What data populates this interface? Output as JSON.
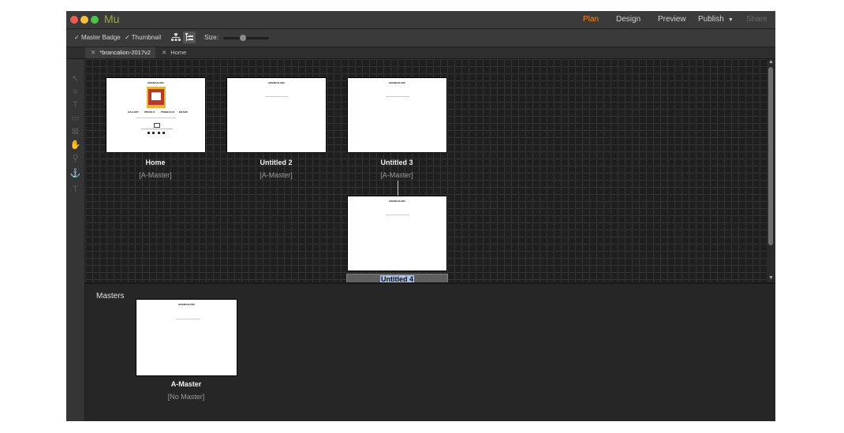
{
  "app": {
    "logo": "Mu",
    "nav": [
      "Plan",
      "Design",
      "Preview",
      "Publish",
      "Share"
    ],
    "active_nav": "Plan"
  },
  "toolbar": {
    "master_badge": "Master Badge",
    "thumbnail": "Thumbnail",
    "size_label": "Size:",
    "size_value": 0.45
  },
  "tabs": [
    "*brancalion-2017v2",
    "Home"
  ],
  "pages": [
    {
      "name": "Home",
      "master": "[A-Master]"
    },
    {
      "name": "Untitled 2",
      "master": "[A-Master]"
    },
    {
      "name": "Untitled 3",
      "master": "[A-Master]"
    },
    {
      "name": "Untitled 4",
      "master": ""
    }
  ],
  "thumb_text": {
    "brand": "BRANCALION",
    "home_nav": [
      "GALLERY",
      "PROFILO",
      "PUBBLICAZ",
      "BRAND"
    ]
  },
  "masters": {
    "label": "Masters",
    "items": [
      {
        "name": "A-Master",
        "master": "[No Master]"
      }
    ]
  },
  "colors": {
    "accent": "#f08a24",
    "logo": "#9aa83a",
    "selection": "#2e6dd6"
  }
}
